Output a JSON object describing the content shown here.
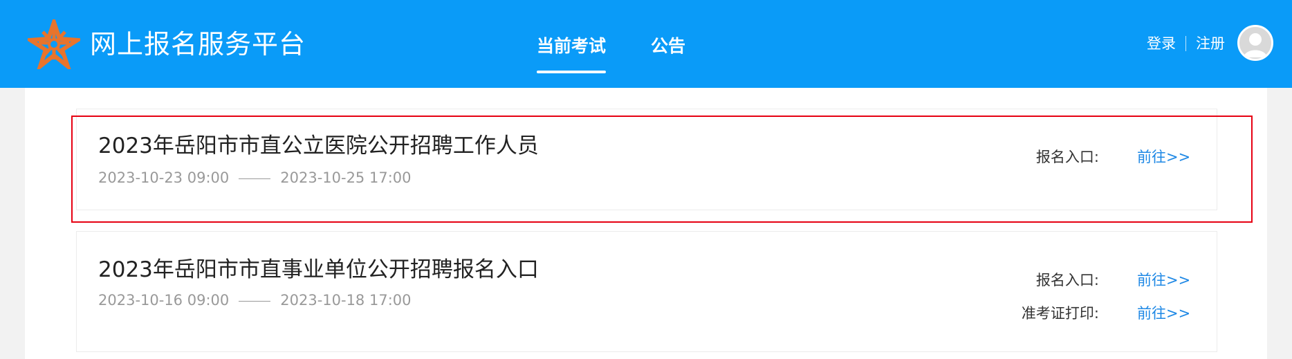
{
  "header": {
    "site_title": "网上报名服务平台",
    "nav": [
      {
        "label": "当前考试",
        "active": true
      },
      {
        "label": "公告",
        "active": false
      }
    ],
    "login": "登录",
    "register": "注册",
    "logo_icon": "star-logo-icon",
    "avatar_icon": "user-avatar-icon"
  },
  "colors": {
    "header_bg": "#0a9bf8",
    "link": "#1e88e5",
    "highlight_border": "#e60012",
    "logo": "#e8742c"
  },
  "exams": [
    {
      "title": "2023年岳阳市市直公立医院公开招聘工作人员",
      "start": "2023-10-23 09:00",
      "end": "2023-10-25 17:00",
      "entries": [
        {
          "label": "报名入口:",
          "link": "前往>>"
        }
      ]
    },
    {
      "title": "2023年岳阳市市直事业单位公开招聘报名入口",
      "start": "2023-10-16 09:00",
      "end": "2023-10-18 17:00",
      "entries": [
        {
          "label": "报名入口:",
          "link": "前往>>"
        },
        {
          "label": "准考证打印:",
          "link": "前往>>"
        }
      ]
    }
  ]
}
